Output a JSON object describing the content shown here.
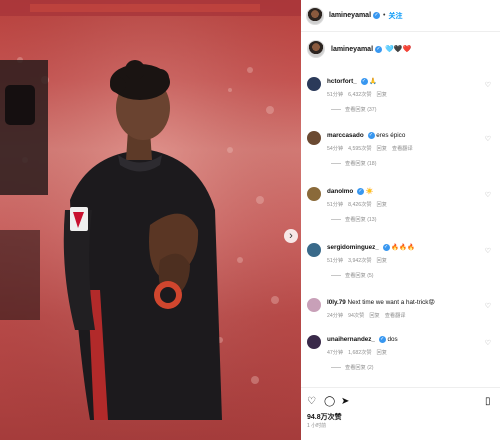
{
  "post": {
    "username": "lamineyamal",
    "follow_label": "关注",
    "separator": "•",
    "caption_username": "lamineyamal",
    "caption_emojis": "🩵🖤❤️",
    "next_arrow": "›",
    "likes": "94.8万次赞",
    "time_ago": "1 小时前"
  },
  "comments": [
    {
      "username": "hctorfort_",
      "text": "🙏",
      "time": "51分钟",
      "likes": "6,432次赞",
      "reply": "回复",
      "translate": "",
      "view_replies": "查看回复 (37)",
      "avatar_color": "#2b3a5a"
    },
    {
      "username": "marccasado",
      "text": "eres épico",
      "time": "54分钟",
      "likes": "4,595次赞",
      "reply": "回复",
      "translate": "查看翻译",
      "view_replies": "查看回复 (18)",
      "avatar_color": "#6b4a32"
    },
    {
      "username": "danolmo",
      "text": "☀️",
      "time": "51分钟",
      "likes": "8,426次赞",
      "reply": "回复",
      "translate": "",
      "view_replies": "查看回复 (13)",
      "avatar_color": "#8a6a3a"
    },
    {
      "username": "sergidominguez_",
      "text": "🔥🔥🔥",
      "time": "51分钟",
      "likes": "3,942次赞",
      "reply": "回复",
      "translate": "",
      "view_replies": "查看回复 (5)",
      "avatar_color": "#3a6a8a"
    },
    {
      "username": "l0ly.79",
      "text": "Next time we want a hat-trick😡",
      "time": "24分钟",
      "likes": "94次赞",
      "reply": "回复",
      "translate": "查看翻译",
      "view_replies": "",
      "avatar_color": "#c8a0b8"
    },
    {
      "username": "unaihernandez_",
      "text": "dos",
      "time": "47分钟",
      "likes": "1,682次赞",
      "reply": "回复",
      "translate": "",
      "view_replies": "查看回复 (2)",
      "avatar_color": "#3a2a4a"
    }
  ],
  "icons": [
    "heart-icon",
    "comment-icon",
    "share-icon",
    "bookmark-icon"
  ],
  "colors": {
    "verified": "#3897f0",
    "follow": "#0095f6",
    "meta": "#8e8e8e"
  }
}
